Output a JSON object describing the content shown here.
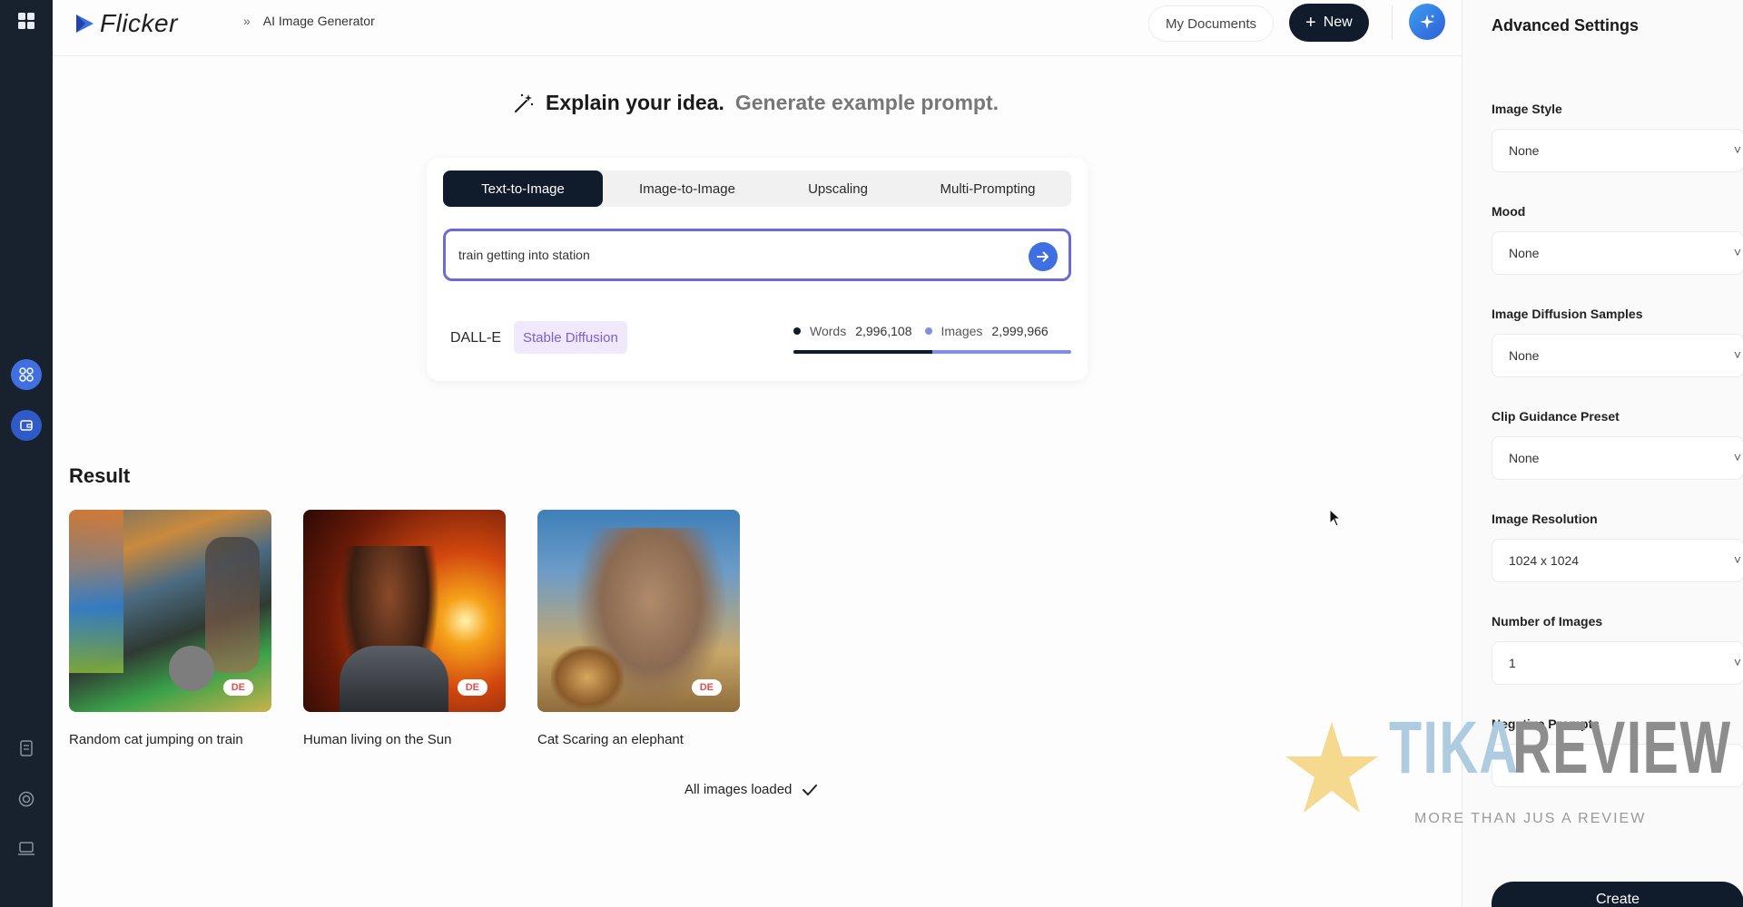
{
  "app": {
    "logo_text": "Flicker",
    "breadcrumb_current": "AI Image Generator",
    "my_documents_label": "My Documents",
    "new_button_label": "New"
  },
  "headline": {
    "primary": "Explain your idea.",
    "secondary": "Generate example prompt."
  },
  "generator": {
    "tabs": [
      {
        "label": "Text-to-Image",
        "active": true
      },
      {
        "label": "Image-to-Image",
        "active": false
      },
      {
        "label": "Upscaling",
        "active": false
      },
      {
        "label": "Multi-Prompting",
        "active": false
      }
    ],
    "prompt_value": "train getting into station",
    "models": {
      "dalle": "DALL-E",
      "stable_diffusion": "Stable Diffusion"
    },
    "stats": {
      "words_label": "Words",
      "words_value": "2,996,108",
      "images_label": "Images",
      "images_value": "2,999,966",
      "words_share": 0.5
    }
  },
  "result": {
    "title": "Result",
    "items": [
      {
        "caption": "Random cat jumping on train",
        "badge": "DE"
      },
      {
        "caption": "Human living on the Sun",
        "badge": "DE"
      },
      {
        "caption": "Cat Scaring an elephant",
        "badge": "DE"
      }
    ],
    "status": "All images loaded"
  },
  "settings": {
    "title": "Advanced Settings",
    "fields": [
      {
        "label": "Image Style",
        "value": "None"
      },
      {
        "label": "Mood",
        "value": "None"
      },
      {
        "label": "Image Diffusion Samples",
        "value": "None"
      },
      {
        "label": "Clip Guidance Preset",
        "value": "None"
      },
      {
        "label": "Image Resolution",
        "value": "1024 x 1024"
      },
      {
        "label": "Number of Images",
        "value": "1"
      },
      {
        "label": "Negative Prompts",
        "value": ""
      }
    ],
    "create_label": "Create"
  },
  "watermark": {
    "word1": "TIKA",
    "word2": "REVIEW",
    "tagline": "MORE THAN JUS A REVIEW"
  },
  "colors": {
    "accent": "#3f6fe0",
    "dark": "#101c2c",
    "prompt_border": "#6b6bd6",
    "sd_chip": "#7b5fd0",
    "badge": "#e04e4e"
  }
}
